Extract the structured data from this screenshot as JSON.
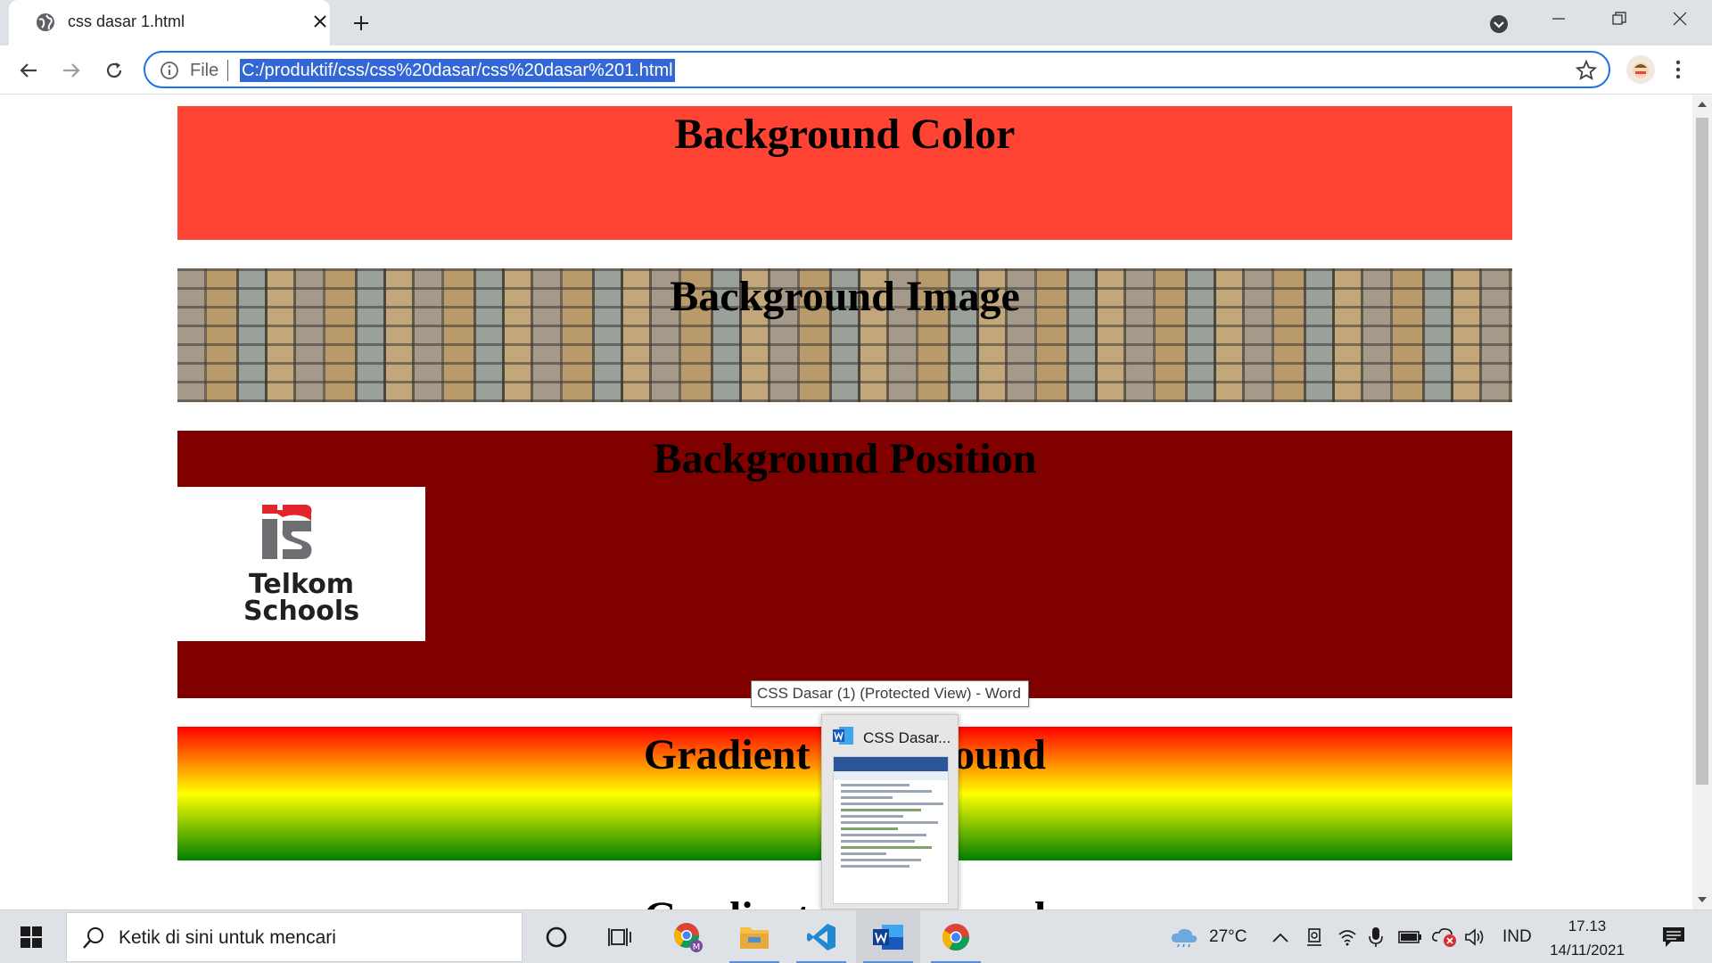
{
  "browser": {
    "tab": {
      "title": "css dasar 1.html"
    },
    "address_bar": {
      "scheme_label": "File",
      "url": "C:/produktif/css/css%20dasar/css%20dasar%201.html"
    }
  },
  "page": {
    "sections": [
      {
        "heading": "Background Color"
      },
      {
        "heading": "Background Image"
      },
      {
        "heading": "Background Position"
      },
      {
        "heading": "Gradient Background"
      },
      {
        "heading": "Gradient Background"
      }
    ],
    "logo": {
      "line1": "Telkom",
      "line2": "Schools"
    }
  },
  "taskbar_preview": {
    "tooltip": "CSS Dasar (1) (Protected View) - Word",
    "thumbnail_title": "CSS Dasar..."
  },
  "taskbar": {
    "search_placeholder": "Ketik di sini untuk mencari",
    "weather": "27°C",
    "language": "IND",
    "time": "17.13",
    "date": "14/11/2021",
    "apps": [
      "cortana-icon",
      "task-view-icon",
      "chrome-profile-icon",
      "file-explorer-icon",
      "vscode-icon",
      "word-icon",
      "chrome-icon"
    ]
  },
  "colors": {
    "section_color": "#ff4433",
    "section_position": "#800000",
    "gradient": [
      "#ff0000",
      "#ffff00",
      "#008000"
    ],
    "omnibox_focus": "#1a73e8"
  }
}
